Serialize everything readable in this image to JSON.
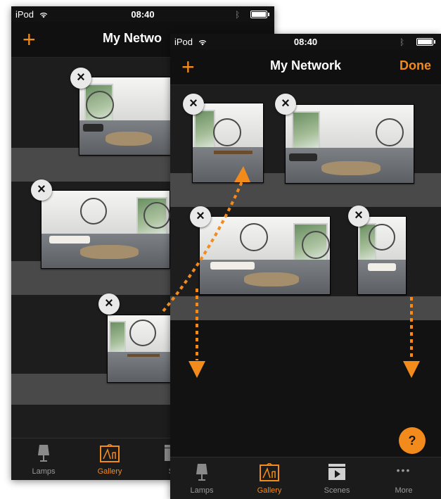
{
  "colors": {
    "accent": "#f28a1c",
    "background": "#121212",
    "band_light": "#494949",
    "band_dark": "#1d1d1d"
  },
  "back_screen": {
    "status": {
      "carrier": "iPod",
      "time": "08:40"
    },
    "nav": {
      "add_icon": "+",
      "title": "My Netwo"
    },
    "tabs": [
      {
        "label": "Lamps",
        "icon": "lamp-icon",
        "active": false
      },
      {
        "label": "Gallery",
        "icon": "gallery-icon",
        "active": true
      },
      {
        "label": "Sc",
        "icon": "scenes-icon",
        "active": false
      }
    ]
  },
  "front_screen": {
    "status": {
      "carrier": "iPod",
      "time": "08:40"
    },
    "nav": {
      "add_icon": "+",
      "title": "My Network",
      "done_label": "Done"
    },
    "help_label": "?",
    "tabs": [
      {
        "label": "Lamps",
        "icon": "lamp-icon",
        "active": false
      },
      {
        "label": "Gallery",
        "icon": "gallery-icon",
        "active": true
      },
      {
        "label": "Scenes",
        "icon": "scenes-icon",
        "active": false
      },
      {
        "label": "More",
        "icon": "more-icon",
        "active": false
      }
    ]
  },
  "delete_label": "×",
  "more_dots": "•••"
}
